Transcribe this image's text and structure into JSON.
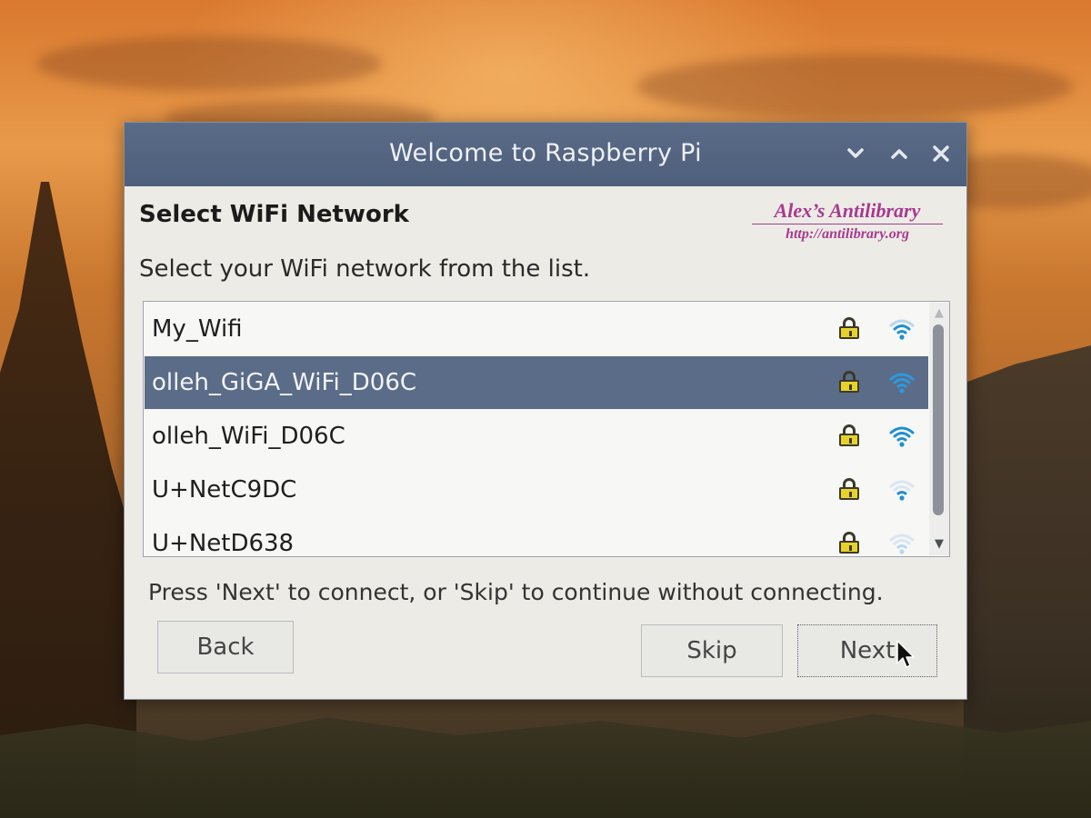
{
  "window": {
    "title": "Welcome to Raspberry Pi",
    "minimize_icon": "chevron-down-icon",
    "maximize_icon": "chevron-up-icon",
    "close_icon": "close-icon"
  },
  "page": {
    "heading": "Select WiFi Network",
    "instruction": "Select your WiFi network from the list.",
    "hint": "Press 'Next' to connect, or 'Skip' to continue without connecting."
  },
  "watermark": {
    "title": "Alex’s Antilibrary",
    "url": "http://antilibrary.org"
  },
  "networks": [
    {
      "name": "My_Wifi",
      "secured": true,
      "signal": "medium",
      "selected": false
    },
    {
      "name": "olleh_GiGA_WiFi_D06C",
      "secured": true,
      "signal": "strong",
      "selected": true
    },
    {
      "name": "olleh_WiFi_D06C",
      "secured": true,
      "signal": "strong",
      "selected": false
    },
    {
      "name": "U+NetC9DC",
      "secured": true,
      "signal": "weak",
      "selected": false
    },
    {
      "name": "U+NetD638",
      "secured": true,
      "signal": "weak",
      "selected": false
    }
  ],
  "buttons": {
    "back": "Back",
    "skip": "Skip",
    "next": "Next"
  },
  "colors": {
    "titlebar": "#5a6b87",
    "selection": "#5b6c88",
    "wifi_strong": "#1d8fd6",
    "wifi_faint": "#b9d6ec",
    "lock": "#e8d22a",
    "watermark": "#a83a8e"
  }
}
